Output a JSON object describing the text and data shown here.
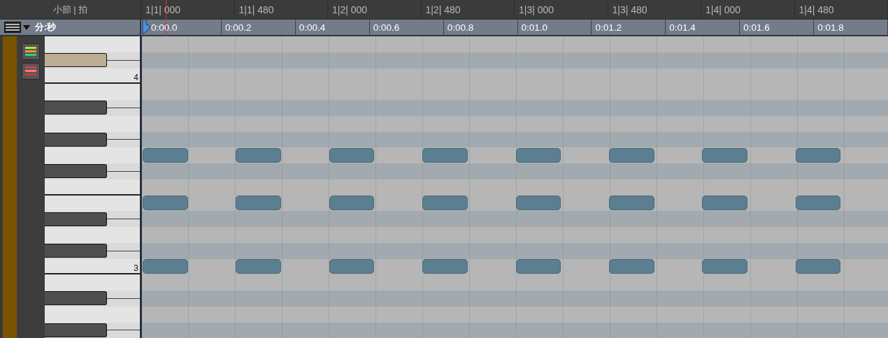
{
  "ruler": {
    "header": "小節 | 拍",
    "bars": [
      "1|1| 000",
      "1|1| 480",
      "1|2| 000",
      "1|2| 480",
      "1|3| 000",
      "1|3| 480",
      "1|4| 000",
      "1|4| 480"
    ]
  },
  "time_ruler": {
    "header": "分:秒",
    "times": [
      "0:00.0",
      "0:00.2",
      "0:00.4",
      "0:00.6",
      "0:00.8",
      "0:01.0",
      "0:01.2",
      "0:01.4",
      "0:01.6",
      "0:01.8"
    ]
  },
  "keyboard": {
    "keys": [
      {
        "kind": "white",
        "selected": false,
        "divider_below": false
      },
      {
        "kind": "black",
        "selected": true
      },
      {
        "kind": "white",
        "selected": false,
        "divider_below": true,
        "label": "4"
      },
      {
        "kind": "white",
        "selected": false,
        "divider_below": false
      },
      {
        "kind": "black",
        "selected": false
      },
      {
        "kind": "white",
        "selected": false,
        "divider_below": false
      },
      {
        "kind": "black",
        "selected": false
      },
      {
        "kind": "white",
        "selected": false,
        "divider_below": false,
        "steps": [
          {
            "kind": "note"
          },
          {
            "kind": "rest"
          },
          {
            "kind": "note"
          },
          {
            "kind": "rest"
          },
          {
            "kind": "note"
          },
          {
            "kind": "rest"
          },
          {
            "kind": "note"
          },
          {
            "kind": "rest"
          },
          {
            "kind": "note"
          },
          {
            "kind": "rest"
          },
          {
            "kind": "note"
          },
          {
            "kind": "rest"
          },
          {
            "kind": "note"
          },
          {
            "kind": "rest"
          },
          {
            "kind": "note"
          },
          {
            "kind": "rest"
          }
        ]
      },
      {
        "kind": "black",
        "selected": false
      },
      {
        "kind": "white",
        "selected": false,
        "divider_below": true
      },
      {
        "kind": "white",
        "selected": false,
        "divider_below": false,
        "steps": [
          {
            "kind": "note"
          },
          {
            "kind": "rest"
          },
          {
            "kind": "note"
          },
          {
            "kind": "rest"
          },
          {
            "kind": "note"
          },
          {
            "kind": "rest"
          },
          {
            "kind": "note"
          },
          {
            "kind": "rest"
          },
          {
            "kind": "note"
          },
          {
            "kind": "rest"
          },
          {
            "kind": "note"
          },
          {
            "kind": "rest"
          },
          {
            "kind": "note"
          },
          {
            "kind": "rest"
          },
          {
            "kind": "note"
          },
          {
            "kind": "rest"
          }
        ]
      },
      {
        "kind": "black",
        "selected": false
      },
      {
        "kind": "white",
        "selected": false,
        "divider_below": false
      },
      {
        "kind": "black",
        "selected": false
      },
      {
        "kind": "white",
        "selected": false,
        "divider_below": true,
        "label": "3",
        "steps": [
          {
            "kind": "note"
          },
          {
            "kind": "rest"
          },
          {
            "kind": "note"
          },
          {
            "kind": "rest"
          },
          {
            "kind": "note"
          },
          {
            "kind": "rest"
          },
          {
            "kind": "note"
          },
          {
            "kind": "rest"
          },
          {
            "kind": "note"
          },
          {
            "kind": "rest"
          },
          {
            "kind": "note"
          },
          {
            "kind": "rest"
          },
          {
            "kind": "note"
          },
          {
            "kind": "rest"
          },
          {
            "kind": "note"
          },
          {
            "kind": "rest"
          }
        ]
      },
      {
        "kind": "white",
        "selected": false,
        "divider_below": false
      },
      {
        "kind": "black",
        "selected": false
      },
      {
        "kind": "white",
        "selected": false,
        "divider_below": false
      },
      {
        "kind": "black",
        "selected": false
      }
    ]
  }
}
